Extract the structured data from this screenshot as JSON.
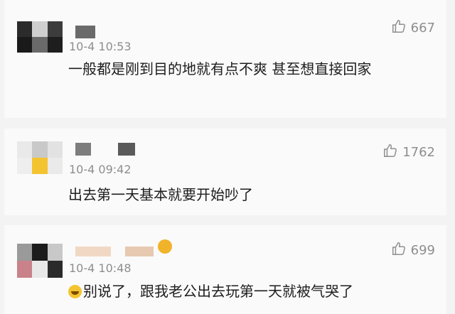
{
  "comments": [
    {
      "time": "10-4 10:53",
      "likes": "667",
      "text": "一般都是刚到目的地就有点不爽 甚至想直接回家"
    },
    {
      "time": "10-4 09:42",
      "likes": "1762",
      "text": "出去第一天基本就要开始吵了"
    },
    {
      "time": "10-4 10:48",
      "likes": "699",
      "text": "别说了，跟我老公出去玩第一天就被气哭了"
    }
  ],
  "icons": {
    "like": "thumbs-up-icon",
    "emoji": "laughing-emoji-icon",
    "badge": "user-badge-icon"
  },
  "colors": {
    "meta": "#8e8e8e",
    "text": "#1d1d1d",
    "card": "#fafafa",
    "divider": "#f3f3f3"
  }
}
